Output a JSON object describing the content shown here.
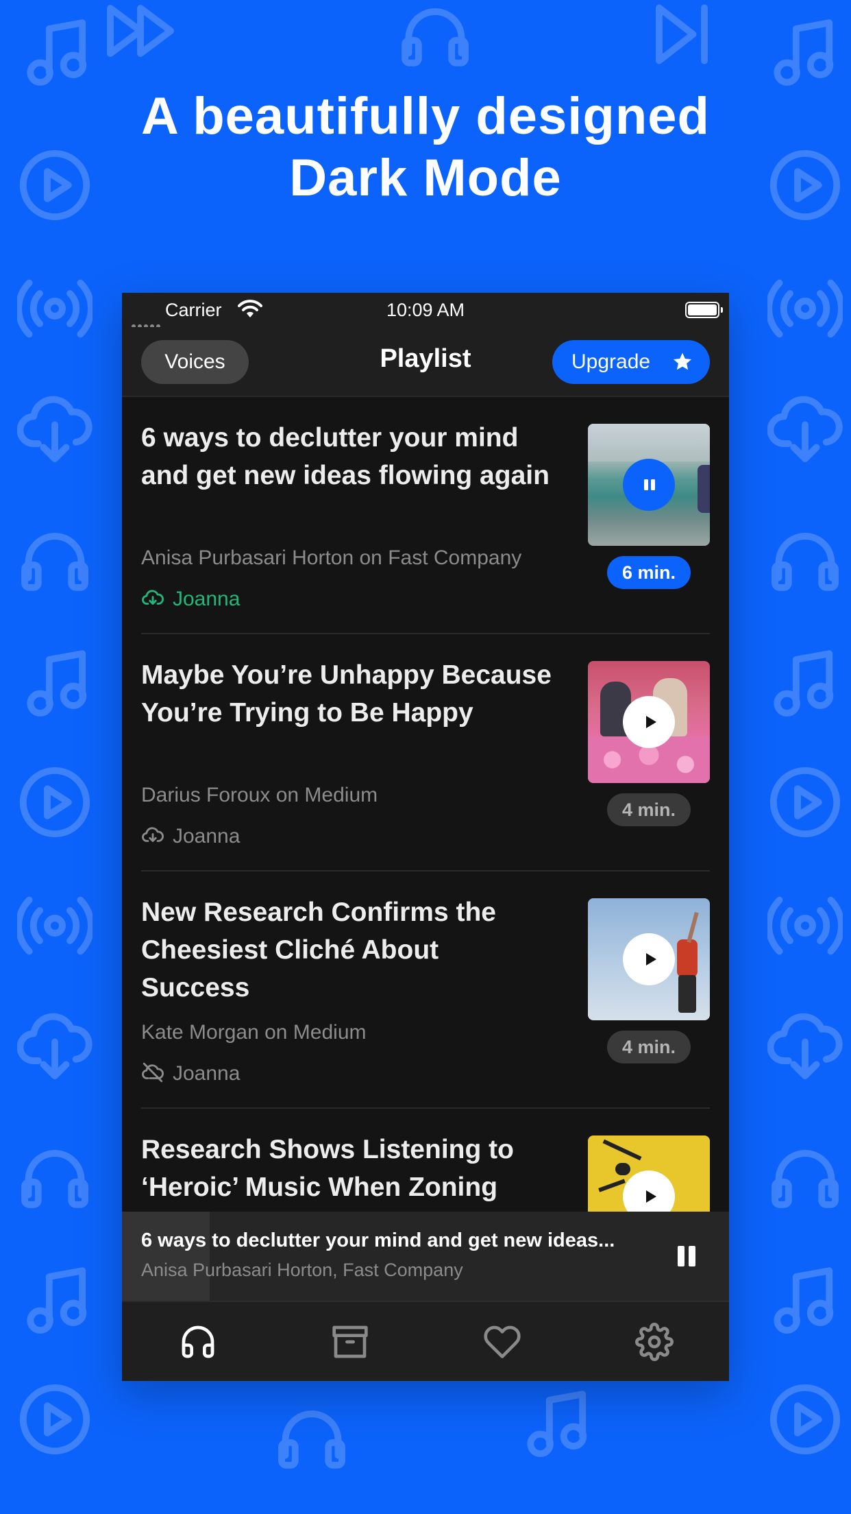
{
  "headline": {
    "line1": "A beautifully designed",
    "line2": "Dark Mode"
  },
  "status_bar": {
    "carrier": "Carrier",
    "time": "10:09 AM"
  },
  "nav": {
    "voices_label": "Voices",
    "title": "Playlist",
    "upgrade_label": "Upgrade"
  },
  "playlist": [
    {
      "title": "6 ways to declutter your mind and get new ideas flowing again",
      "source": "Anisa Purbasari Horton on Fast Company",
      "voice": "Joanna",
      "voice_status": "downloaded",
      "duration": "6 min.",
      "state": "playing"
    },
    {
      "title": "Maybe You’re Unhappy Because You’re Trying to Be Happy",
      "source": "Darius Foroux on Medium",
      "voice": "Joanna",
      "voice_status": "download",
      "duration": "4 min.",
      "state": "paused"
    },
    {
      "title": "New Research Confirms the Cheesiest Cliché About Success",
      "source": "Kate Morgan on Medium",
      "voice": "Joanna",
      "voice_status": "offline",
      "duration": "4 min.",
      "state": "paused"
    },
    {
      "title": "Research Shows Listening to ‘Heroic’ Music When Zoning",
      "source": "",
      "voice": "",
      "voice_status": "",
      "duration": "",
      "state": "paused"
    }
  ],
  "mini_player": {
    "title": "6 ways to declutter your mind and get new ideas...",
    "subtitle": "Anisa Purbasari Horton, Fast Company",
    "progress": 0.145
  },
  "tabs": [
    {
      "icon": "headphones-icon",
      "active": true
    },
    {
      "icon": "archive-icon",
      "active": false
    },
    {
      "icon": "heart-icon",
      "active": false
    },
    {
      "icon": "gear-icon",
      "active": false
    }
  ],
  "colors": {
    "background": "#0c63fb",
    "accent": "#0c63fb",
    "downloaded": "#1fb87a",
    "surface": "#141414"
  }
}
